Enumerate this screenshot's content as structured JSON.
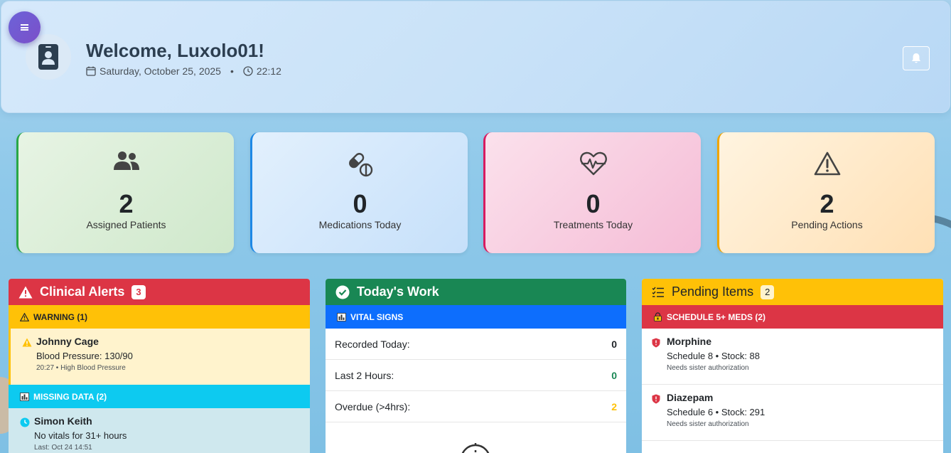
{
  "header": {
    "welcome": "Welcome, Luxolo01!",
    "date": "Saturday, October 25, 2025",
    "separator": "•",
    "time": "22:12"
  },
  "stats": [
    {
      "value": "2",
      "label": "Assigned Patients",
      "icon": "users-icon"
    },
    {
      "value": "0",
      "label": "Medications Today",
      "icon": "pills-icon"
    },
    {
      "value": "0",
      "label": "Treatments Today",
      "icon": "heart-pulse-icon"
    },
    {
      "value": "2",
      "label": "Pending Actions",
      "icon": "warning-icon"
    }
  ],
  "clinical_alerts": {
    "title": "Clinical Alerts",
    "count": "3",
    "warning_header": "WARNING (1)",
    "warning_items": [
      {
        "name": "Johnny Cage",
        "desc": "Blood Pressure: 130/90",
        "meta": "20:27 • High Blood Pressure"
      }
    ],
    "missing_header": "MISSING DATA (2)",
    "missing_items": [
      {
        "name": "Simon Keith",
        "desc": "No vitals for 31+ hours",
        "meta": "Last: Oct 24 14:51"
      }
    ]
  },
  "todays_work": {
    "title": "Today's Work",
    "vitals_header": "VITAL SIGNS",
    "rows": [
      {
        "label": "Recorded Today:",
        "value": "0"
      },
      {
        "label": "Last 2 Hours:",
        "value": "0"
      },
      {
        "label": "Overdue (>4hrs):",
        "value": "2"
      }
    ]
  },
  "pending_items": {
    "title": "Pending Items",
    "count": "2",
    "schedule_header": "SCHEDULE 5+ MEDS (2)",
    "meds": [
      {
        "name": "Morphine",
        "desc": "Schedule 8 • Stock: 88",
        "meta": "Needs sister authorization"
      },
      {
        "name": "Diazepam",
        "desc": "Schedule 6 • Stock: 291",
        "meta": "Needs sister authorization"
      }
    ]
  },
  "colors": {
    "danger": "#dc3545",
    "warning": "#ffc107",
    "success": "#198754",
    "info": "#0dcaf0",
    "primary": "#0d6efd"
  }
}
